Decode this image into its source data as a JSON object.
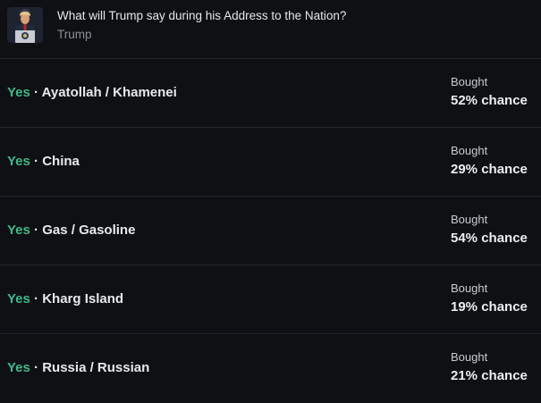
{
  "market": {
    "title": "What will Trump say during his Address to the Nation?",
    "subtitle": "Trump"
  },
  "rows": [
    {
      "side": "Yes",
      "sep": " · ",
      "outcome": "Ayatollah / Khamenei",
      "status": "Bought",
      "chance": "52% chance"
    },
    {
      "side": "Yes",
      "sep": " · ",
      "outcome": "China",
      "status": "Bought",
      "chance": "29% chance"
    },
    {
      "side": "Yes",
      "sep": " · ",
      "outcome": "Gas / Gasoline",
      "status": "Bought",
      "chance": "54% chance"
    },
    {
      "side": "Yes",
      "sep": " · ",
      "outcome": "Kharg Island",
      "status": "Bought",
      "chance": "19% chance"
    },
    {
      "side": "Yes",
      "sep": " · ",
      "outcome": "Russia / Russian",
      "status": "Bought",
      "chance": "21% chance"
    }
  ],
  "colors": {
    "background": "#0f1014",
    "yes": "#3fb888",
    "divider": "#24262c"
  }
}
